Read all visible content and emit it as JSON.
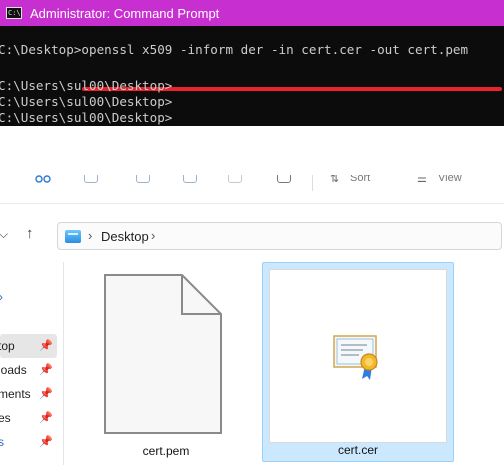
{
  "cmd": {
    "title": "Administrator: Command Prompt",
    "icon": "cmd-icon",
    "lines": [
      "C:\\Desktop>openssl x509 -inform der -in cert.cer -out cert.pem",
      "",
      "C:\\Users\\sul00\\Desktop>",
      "C:\\Users\\sul00\\Desktop>",
      "C:\\Users\\sul00\\Desktop>"
    ],
    "highlight_color": "#e8232b"
  },
  "toolbar": {
    "sort_label": "Sort",
    "view_label": "View"
  },
  "address": {
    "location": "Desktop"
  },
  "sidebar": {
    "items": [
      {
        "label": "top",
        "pinned": true
      },
      {
        "label": "loads",
        "pinned": true
      },
      {
        "label": "ments",
        "pinned": true
      },
      {
        "label": "es",
        "pinned": true
      },
      {
        "label": "s",
        "pinned": true
      }
    ]
  },
  "files": [
    {
      "name": "cert.pem",
      "type": "blank-document-icon",
      "selected": false
    },
    {
      "name": "cert.cer",
      "type": "certificate-icon",
      "selected": true
    }
  ],
  "colors": {
    "title_bar": "#c82fd0",
    "console_bg": "#0c0c0c",
    "selection": "#cce8ff"
  }
}
